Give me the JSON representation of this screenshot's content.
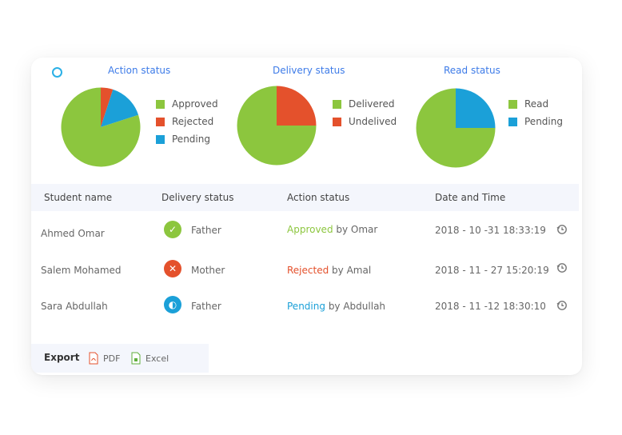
{
  "charts": [
    {
      "title": "Action status",
      "slices": [
        {
          "label": "Approved",
          "value": 0.8,
          "color": "#8cc63e"
        },
        {
          "label": "Rejected",
          "value": 0.05,
          "color": "#e4512c"
        },
        {
          "label": "Pending",
          "value": 0.15,
          "color": "#1ba0d8"
        }
      ]
    },
    {
      "title": "Delivery status",
      "slices": [
        {
          "label": "Delivered",
          "value": 0.75,
          "color": "#8cc63e"
        },
        {
          "label": "Undelived",
          "value": 0.25,
          "color": "#e4512c"
        }
      ]
    },
    {
      "title": "Read status",
      "slices": [
        {
          "label": "Read",
          "value": 0.75,
          "color": "#8cc63e"
        },
        {
          "label": "Pending",
          "value": 0.25,
          "color": "#1ba0d8"
        }
      ]
    }
  ],
  "table": {
    "headers": {
      "student_name": "Student name",
      "delivery_status": "Delivery status",
      "action_status": "Action status",
      "date_time": "Date and Time"
    },
    "rows": [
      {
        "student": "Ahmed Omar",
        "delivery_icon": "check-icon",
        "delivery_color": "#8cc63e",
        "delivered_to": "Father",
        "action": "Approved",
        "action_color": "#8cc63e",
        "by_text": "by Omar",
        "datetime": "2018 - 10 -31  18:33:19"
      },
      {
        "student": "Salem Mohamed",
        "delivery_icon": "x-icon",
        "delivery_color": "#e4512c",
        "delivered_to": "Mother",
        "action": "Rejected",
        "action_color": "#e4512c",
        "by_text": "by Amal",
        "datetime": "2018 - 11 - 27  15:20:19"
      },
      {
        "student": "Sara Abdullah",
        "delivery_icon": "half-circle-icon",
        "delivery_color": "#1ba0d8",
        "delivered_to": "Father",
        "action": "Pending",
        "action_color": "#1ba0d8",
        "by_text": "by Abdullah",
        "datetime": "2018 - 11 -12  18:30:10"
      }
    ]
  },
  "export": {
    "label": "Export",
    "pdf": "PDF",
    "excel": "Excel"
  }
}
